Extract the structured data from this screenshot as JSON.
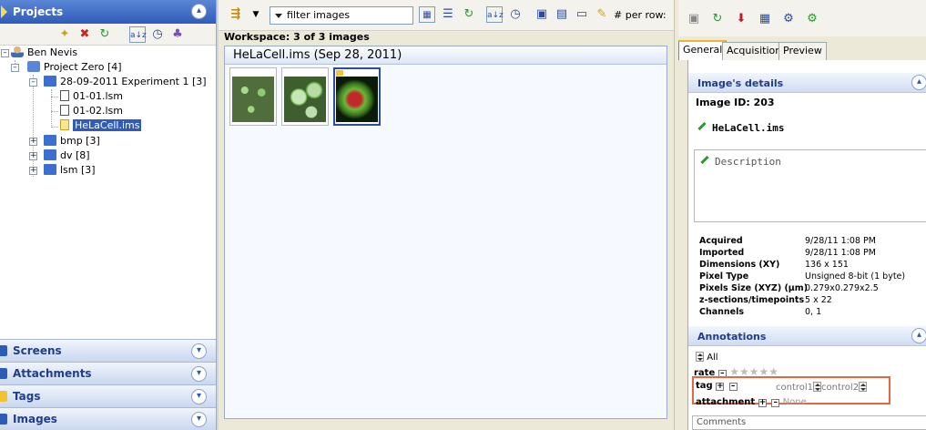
{
  "left": {
    "projects_title": "Projects",
    "tree": {
      "user": "Ben Nevis",
      "project": "Project Zero [4]",
      "dataset": "28-09-2011 Experiment 1 [3]",
      "images": [
        "01-01.lsm",
        "01-02.lsm",
        "HeLaCell.ims"
      ],
      "other_datasets": [
        "bmp [3]",
        "dv [8]",
        "lsm [3]"
      ]
    },
    "sections": [
      "Screens",
      "Attachments",
      "Tags",
      "Images"
    ]
  },
  "middle": {
    "filter_placeholder": "filter  images",
    "per_row_label": "# per row:",
    "workspace_label": "Workspace: 3 of 3 images",
    "browser_title": "HeLaCell.ims (Sep 28, 2011)"
  },
  "right": {
    "tabs": [
      "General",
      "Acquisition",
      "Preview"
    ],
    "details_title": "Image's details",
    "image_id": "Image ID: 203",
    "image_name": "HeLaCell.ims",
    "description_placeholder": "Description",
    "details": [
      {
        "k": "Acquired",
        "v": "9/28/11 1:08 PM"
      },
      {
        "k": "Imported",
        "v": "9/28/11 1:08 PM"
      },
      {
        "k": "Dimensions (XY)",
        "v": "136 x 151"
      },
      {
        "k": "Pixel Type",
        "v": "Unsigned 8-bit (1 byte)"
      },
      {
        "k": "Pixels Size (XYZ) (µm)",
        "v": "0.279x0.279x2.5"
      },
      {
        "k": "z-sections/timepoints",
        "v": "5 x 22"
      },
      {
        "k": "Channels",
        "v": "0, 1"
      }
    ],
    "annotations_title": "Annotations",
    "all_label": "All",
    "rate_label": "rate",
    "tag_label": "tag",
    "tags": [
      "control1",
      "control2"
    ],
    "attachment_label": "attachment",
    "attachment_value": "None",
    "comments_placeholder": "Comments"
  }
}
